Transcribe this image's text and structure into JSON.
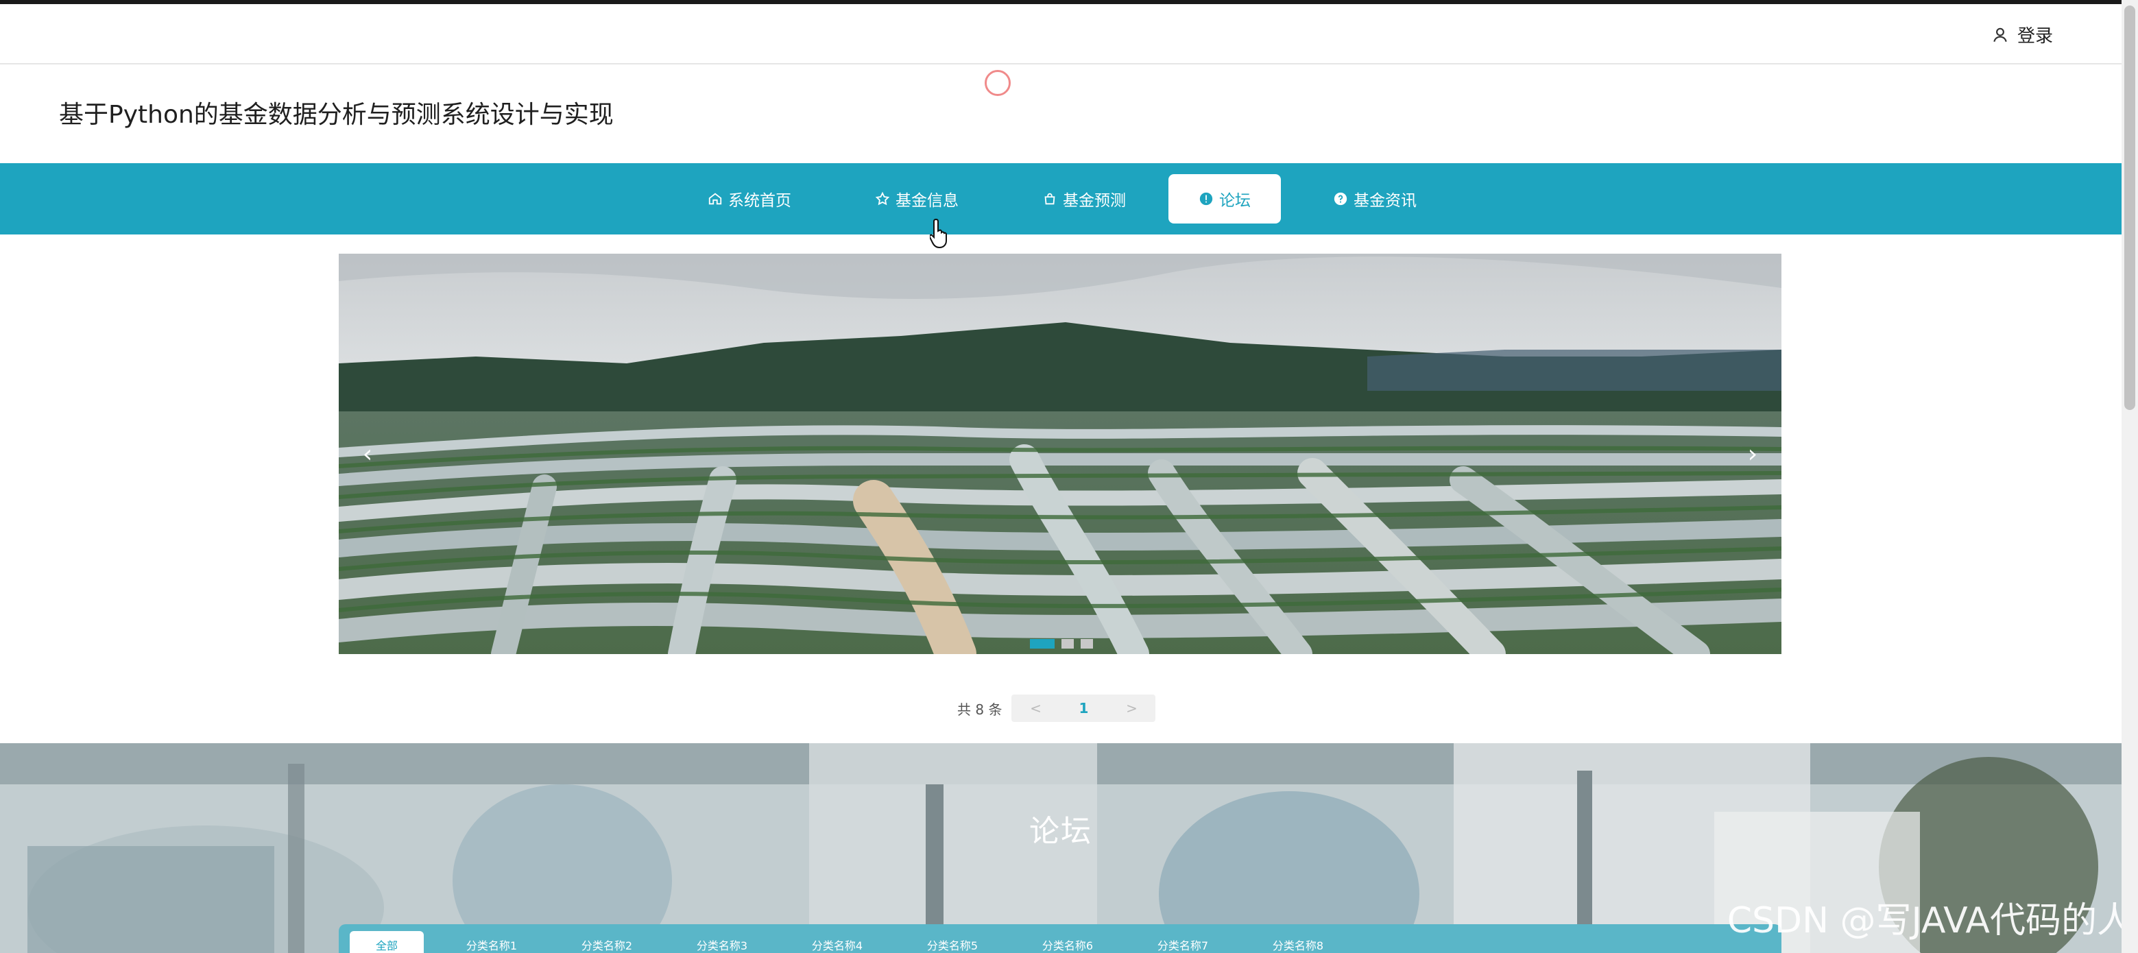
{
  "header": {
    "login_label": "登录",
    "login_icon": "user-icon"
  },
  "site": {
    "title": "基于Python的基金数据分析与预测系统设计与实现"
  },
  "nav": {
    "accent": "#1ea4bf",
    "items": [
      {
        "label": "系统首页",
        "icon": "home-icon"
      },
      {
        "label": "基金信息",
        "icon": "star-icon"
      },
      {
        "label": "基金预测",
        "icon": "bag-icon"
      },
      {
        "label": "论坛",
        "icon": "info-circle-icon",
        "active": true
      },
      {
        "label": "基金资讯",
        "icon": "question-circle-icon"
      }
    ]
  },
  "carousel": {
    "prev_label": "‹",
    "next_label": "›",
    "slide_count": 3,
    "active_slide": 1
  },
  "pagination": {
    "total_text": "共 8 条",
    "prev_label": "<",
    "current_page": "1",
    "next_label": ">"
  },
  "forum": {
    "title": "论坛",
    "categories": [
      "全部",
      "分类名称1",
      "分类名称2",
      "分类名称3",
      "分类名称4",
      "分类名称5",
      "分类名称6",
      "分类名称7",
      "分类名称8"
    ]
  },
  "watermark": "CSDN @写JAVA代码的人"
}
